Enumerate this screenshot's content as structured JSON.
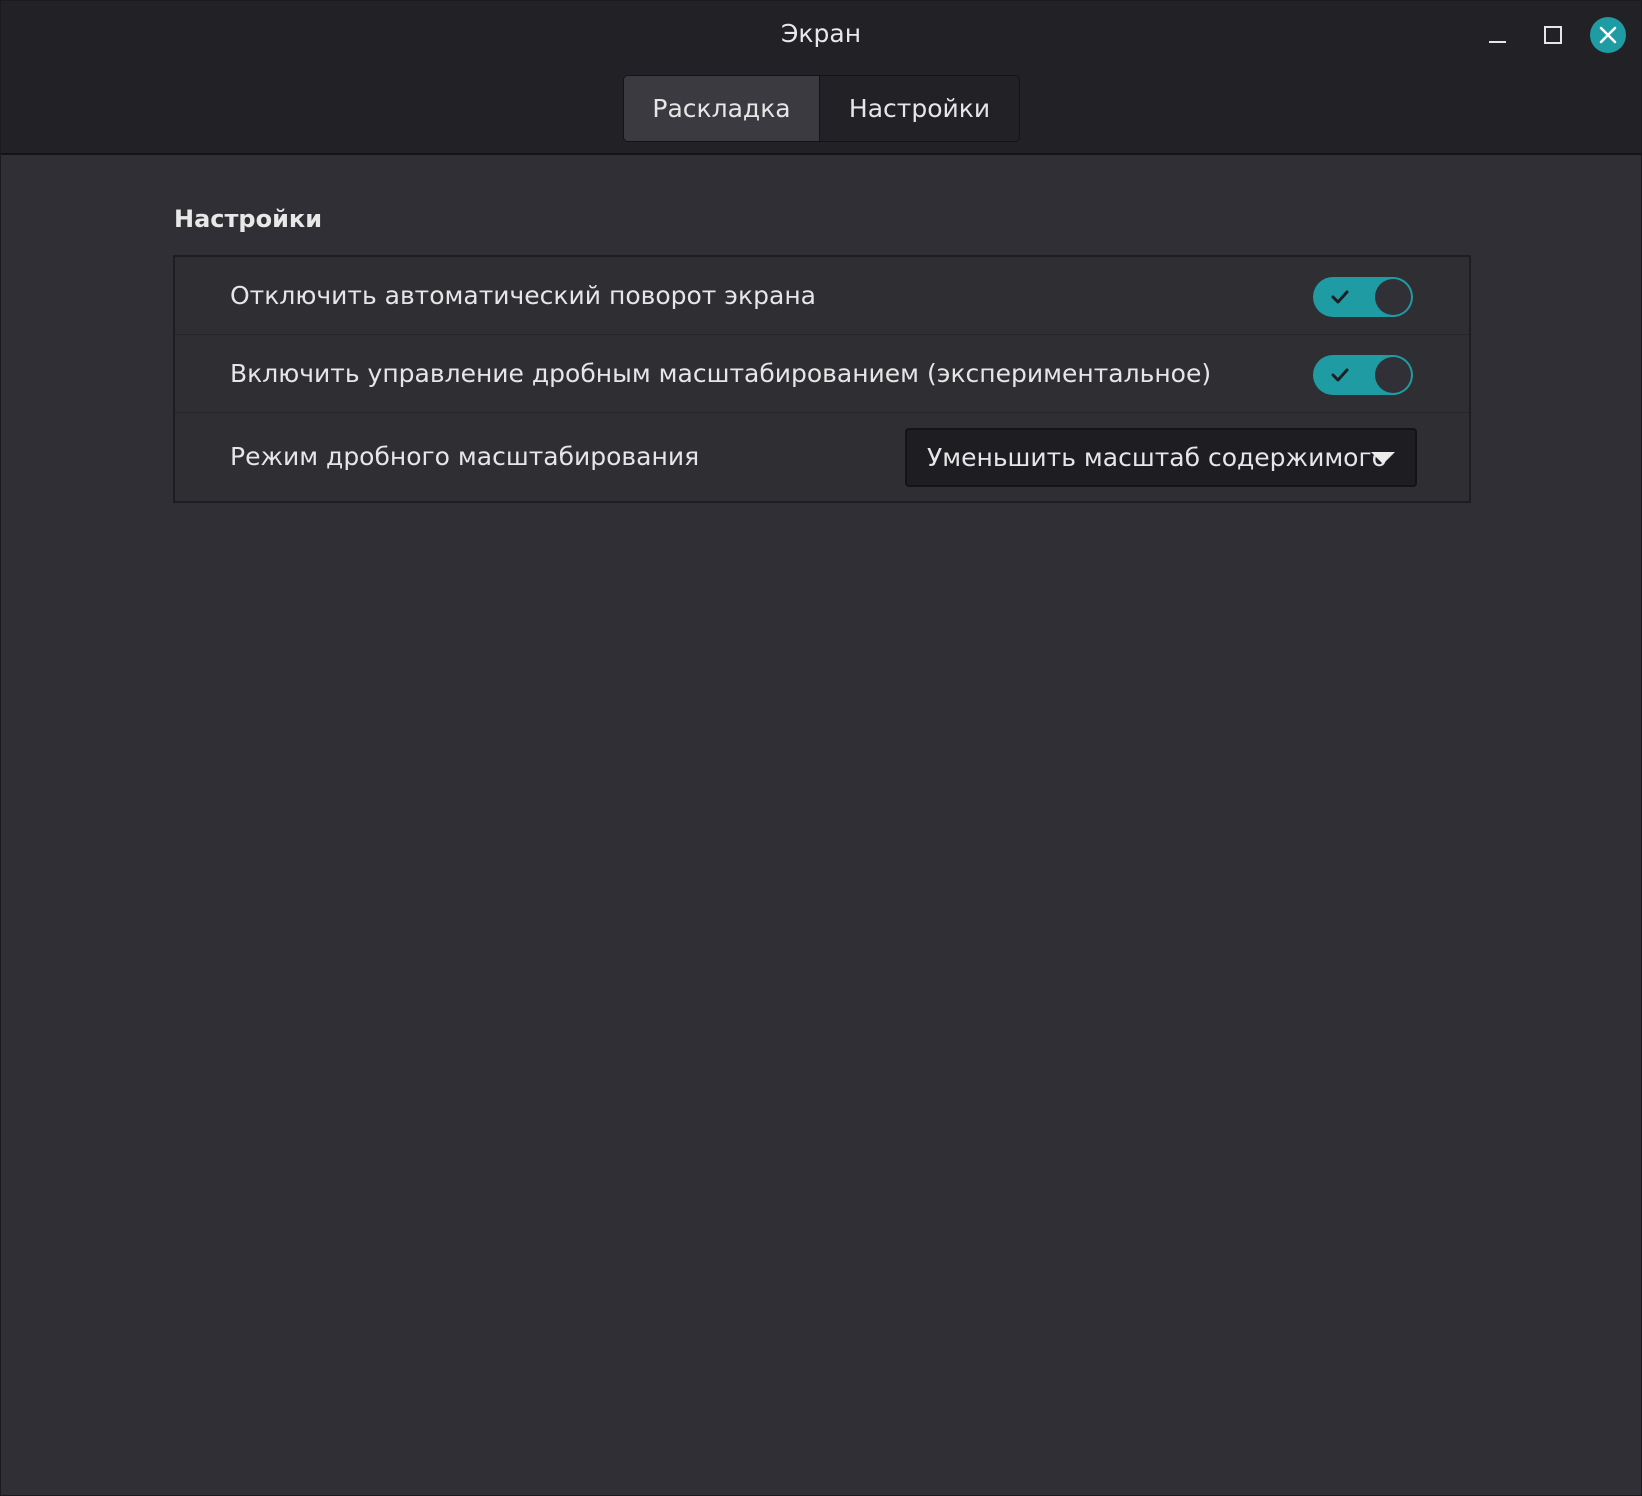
{
  "window": {
    "title": "Экран",
    "controls": {
      "minimize": "minimize-icon",
      "maximize": "maximize-icon",
      "close": "close-icon"
    },
    "accent_color": "#1f9ba4"
  },
  "tabs": [
    {
      "label": "Раскладка",
      "active": true
    },
    {
      "label": "Настройки",
      "active": false
    }
  ],
  "settings": {
    "section_title": "Настройки",
    "rows": [
      {
        "label": "Отключить автоматический поворот экрана",
        "type": "switch",
        "checked": true
      },
      {
        "label": "Включить управление дробным масштабированием (экспериментальное)",
        "type": "switch",
        "checked": true
      },
      {
        "label": "Режим дробного масштабирования",
        "type": "dropdown",
        "value": "Уменьшить масштаб содержимого"
      }
    ]
  }
}
